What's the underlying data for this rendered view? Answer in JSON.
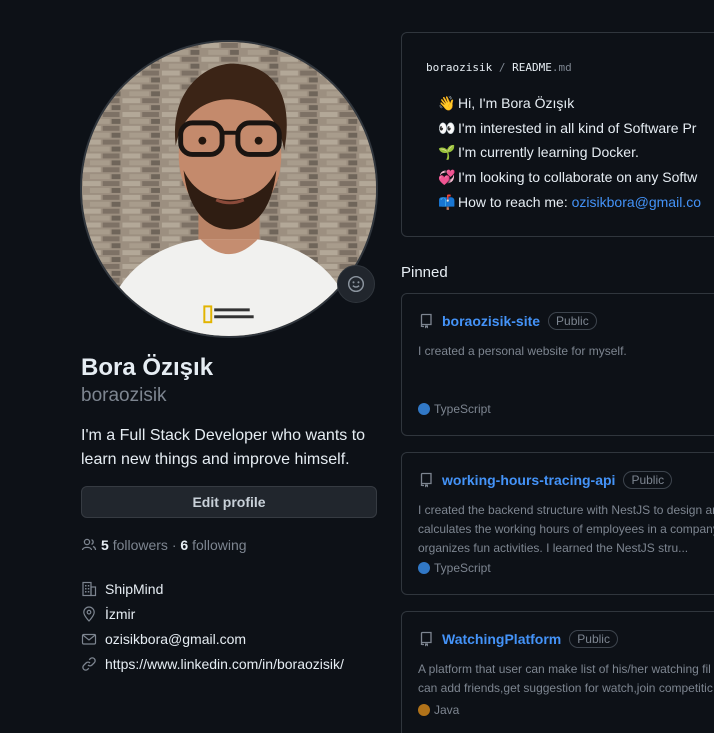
{
  "profile": {
    "name": "Bora Özışık",
    "login": "boraozisik",
    "bio": "I'm a Full Stack Developer who wants to learn new things and improve himself.",
    "edit_label": "Edit profile",
    "followers_count": "5",
    "followers_label": "followers",
    "separator": "·",
    "following_count": "6",
    "following_label": "following",
    "company": "ShipMind",
    "location": "İzmir",
    "email": "ozisikbora@gmail.com",
    "website": "https://www.linkedin.com/in/boraozisik/"
  },
  "readme": {
    "owner": "boraozisik",
    "sep": "/",
    "file": "README",
    "ext": ".md",
    "items": [
      {
        "emoji": "👋",
        "text": "Hi, I'm Bora Özışık"
      },
      {
        "emoji": "👀",
        "text": "I'm interested in all kind of Software Pr"
      },
      {
        "emoji": "🌱",
        "text": "I'm currently learning Docker."
      },
      {
        "emoji": "💞",
        "text": "I'm looking to collaborate on any Softw"
      },
      {
        "emoji": "📫",
        "text": "How to reach me: ",
        "link": "ozisikbora@gmail.co"
      }
    ]
  },
  "pinned": {
    "title": "Pinned",
    "repos": [
      {
        "name": "boraozisik-site",
        "visibility": "Public",
        "desc": [
          "I created a personal website for myself."
        ],
        "language": "TypeScript",
        "lang_color": "#3178c6"
      },
      {
        "name": "working-hours-tracing-api",
        "visibility": "Public",
        "desc": [
          "I created the backend structure with NestJS to design an",
          "calculates the working hours of employees in a company",
          "organizes fun activities. I learned the NestJS stru..."
        ],
        "language": "TypeScript",
        "lang_color": "#3178c6"
      },
      {
        "name": "WatchingPlatform",
        "visibility": "Public",
        "desc": [
          "A platform that user can make list of his/her watching fil",
          "can add friends,get suggestion for watch,join competitic"
        ],
        "language": "Java",
        "lang_color": "#b07219"
      }
    ]
  },
  "icons": {
    "status": "smiley-icon",
    "people": "people-icon",
    "company": "organization-icon",
    "location": "location-icon",
    "email": "mail-icon",
    "link": "link-icon",
    "repo": "repo-icon"
  }
}
